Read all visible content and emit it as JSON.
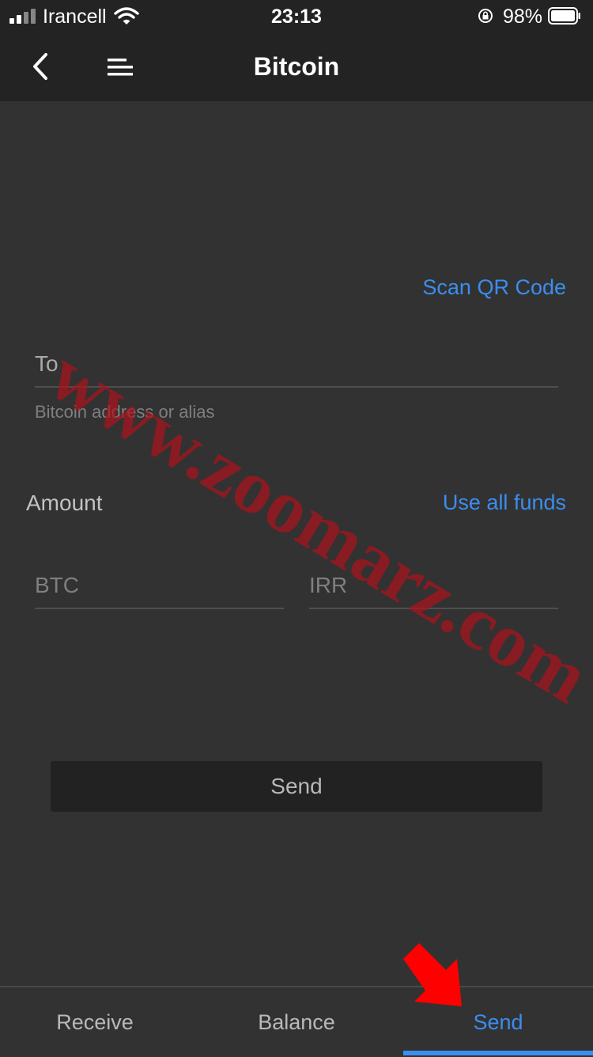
{
  "status_bar": {
    "carrier": "Irancell",
    "time": "23:13",
    "battery_percent": "98%",
    "icons": [
      "signal-icon",
      "wifi-icon",
      "rotation-lock-icon",
      "battery-icon"
    ]
  },
  "nav": {
    "title": "Bitcoin",
    "back_icon": "chevron-left-icon",
    "menu_icon": "menu-icon"
  },
  "form": {
    "scan_qr_label": "Scan QR Code",
    "to_label": "To",
    "to_placeholder": "Bitcoin address or alias",
    "amount_label": "Amount",
    "use_all_funds_label": "Use all funds",
    "btc_placeholder": "BTC",
    "irr_placeholder": "IRR",
    "send_button_label": "Send"
  },
  "tabs": [
    {
      "label": "Receive",
      "active": false
    },
    {
      "label": "Balance",
      "active": false
    },
    {
      "label": "Send",
      "active": true
    }
  ],
  "watermark": "www.zoomarz.com",
  "colors": {
    "background": "#323232",
    "topbar": "#232323",
    "accent": "#3a8ef0",
    "watermark": "#aa121c",
    "arrow": "#ff0000"
  }
}
